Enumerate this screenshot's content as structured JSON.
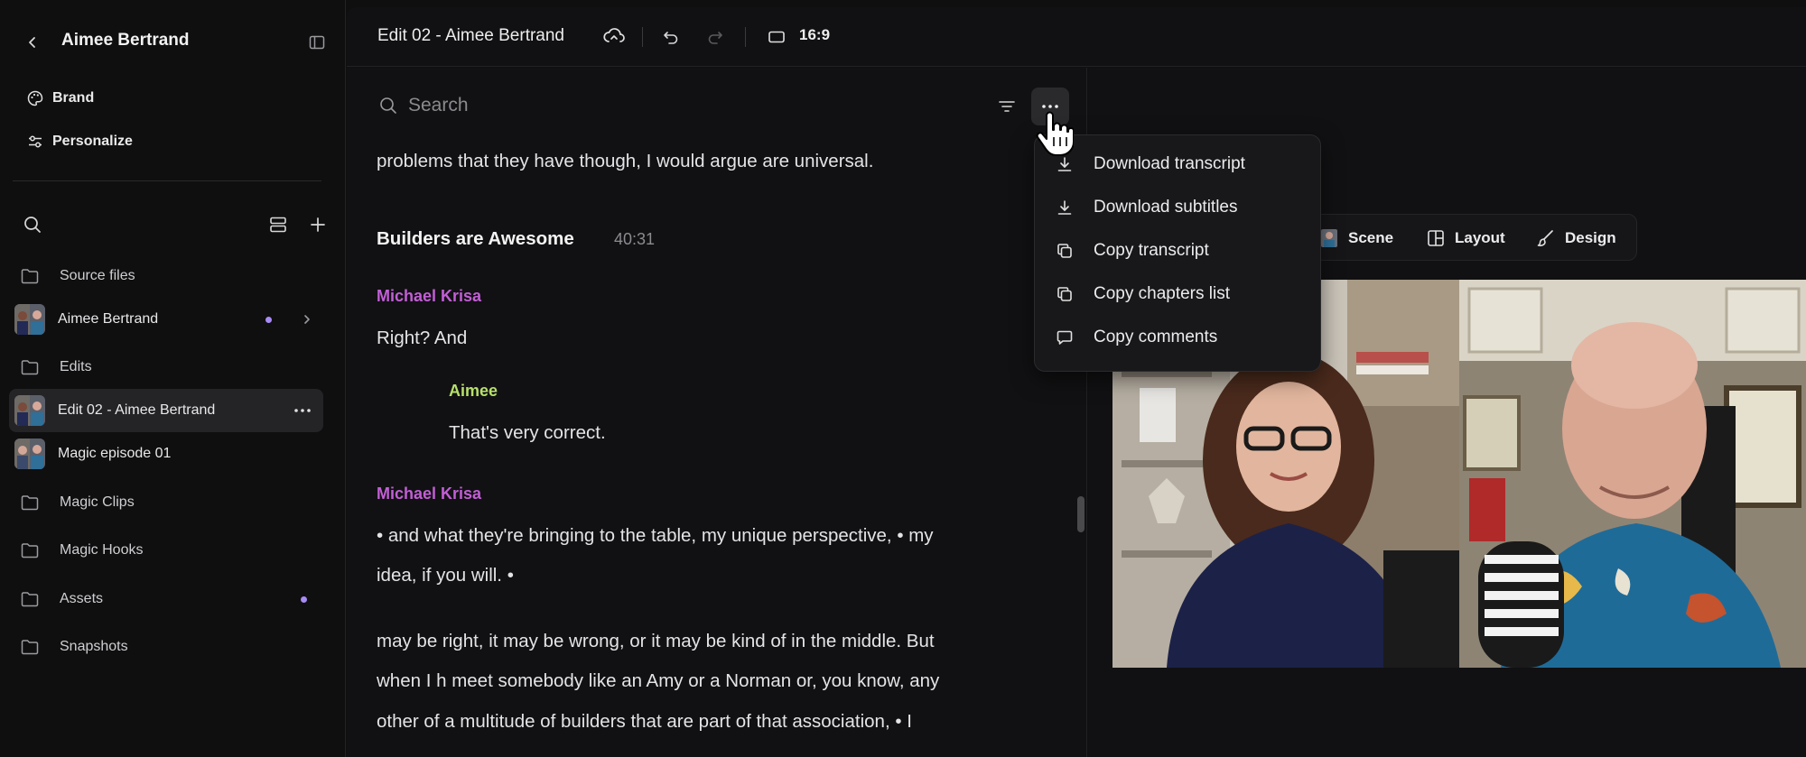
{
  "sidebar": {
    "title": "Aimee Bertrand",
    "nav": [
      {
        "label": "Brand",
        "icon": "palette-icon"
      },
      {
        "label": "Personalize",
        "icon": "sliders-icon"
      }
    ],
    "tree": [
      {
        "label": "Source files",
        "type": "folder"
      },
      {
        "label": "Aimee Bertrand",
        "type": "file"
      },
      {
        "label": "Edits",
        "type": "folder"
      },
      {
        "label": "Edit 02 - Aimee Bertrand",
        "type": "file"
      },
      {
        "label": "Magic episode 01",
        "type": "file"
      },
      {
        "label": "Magic Clips",
        "type": "folder"
      },
      {
        "label": "Magic Hooks",
        "type": "folder"
      },
      {
        "label": "Assets",
        "type": "folder"
      },
      {
        "label": "Snapshots",
        "type": "folder"
      }
    ]
  },
  "topbar": {
    "title": "Edit 02 - Aimee Bertrand",
    "aspect_ratio": "16:9"
  },
  "transcript": {
    "search_placeholder": "Search",
    "line_0": "problems that they have though, I would argue are universal.",
    "chapter_title": "Builders are Awesome",
    "chapter_time": "40:31",
    "speaker_1": "Michael Krisa",
    "line_1": "Right? And",
    "speaker_2": "Aimee",
    "line_2": "That's very correct.",
    "speaker_3": "Michael Krisa",
    "line_3a": "• and what they're bringing to the table, my unique perspective, • my",
    "line_3b": "idea, if you will. •",
    "line_4a": "may be right, it may be wrong, or it may be kind of in the middle. But",
    "line_4b": "when I h meet somebody like an Amy or a Norman or, you know, any",
    "line_4c": "other of a multitude of builders that are part of that association, • I"
  },
  "menu": {
    "items": [
      {
        "label": "Download transcript",
        "icon": "download-icon"
      },
      {
        "label": "Download subtitles",
        "icon": "download-icon"
      },
      {
        "label": "Copy transcript",
        "icon": "copy-icon"
      },
      {
        "label": "Copy chapters list",
        "icon": "copy-icon"
      },
      {
        "label": "Copy comments",
        "icon": "comment-icon"
      }
    ]
  },
  "preview": {
    "scene_label": "Scene",
    "layout_label": "Layout",
    "design_label": "Design"
  },
  "colors": {
    "speaker_michael": "#c25fd6",
    "speaker_aimee": "#b7e06b",
    "accent_dot": "#a88bf5",
    "background": "#0f0f10"
  }
}
